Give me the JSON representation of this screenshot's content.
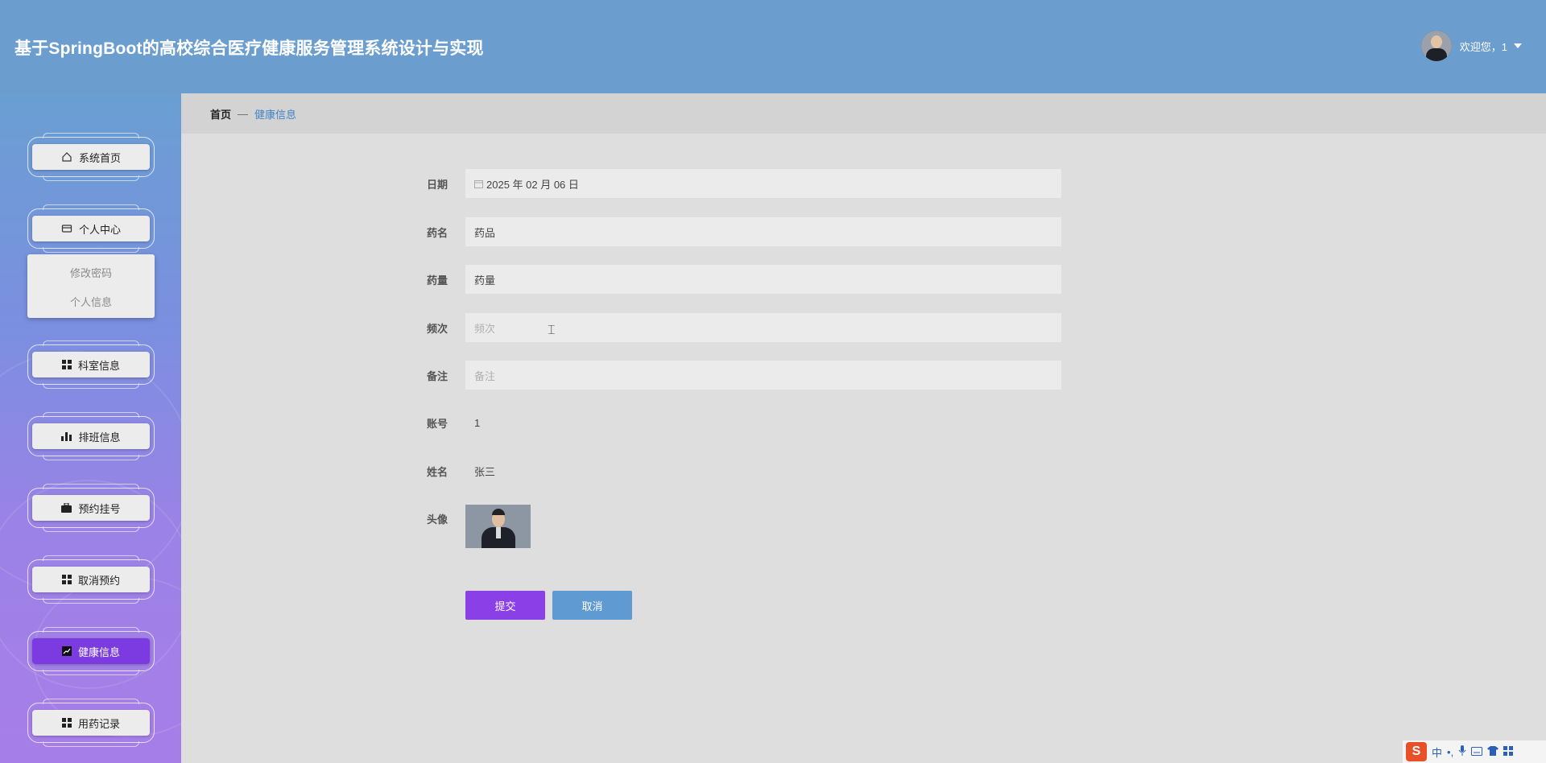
{
  "header": {
    "title": "基于SpringBoot的高校综合医疗健康服务管理系统设计与实现",
    "welcome": "欢迎您，1"
  },
  "sidebar": {
    "items": [
      {
        "label": "系统首页",
        "icon": "home-icon"
      },
      {
        "label": "个人中心",
        "icon": "wallet-icon"
      },
      {
        "label": "科室信息",
        "icon": "grid-icon"
      },
      {
        "label": "排班信息",
        "icon": "bar-chart-icon"
      },
      {
        "label": "预约挂号",
        "icon": "briefcase-icon"
      },
      {
        "label": "取消预约",
        "icon": "grid-icon"
      },
      {
        "label": "健康信息",
        "icon": "line-chart-icon",
        "active": true
      },
      {
        "label": "用药记录",
        "icon": "grid-icon"
      }
    ],
    "submenu": [
      "修改密码",
      "个人信息"
    ]
  },
  "breadcrumb": {
    "home": "首页",
    "separator": "—",
    "current": "健康信息"
  },
  "form": {
    "date": {
      "label": "日期",
      "value": "2025 年 02 月 06 日"
    },
    "drug_name": {
      "label": "药名",
      "value": "药品"
    },
    "dosage": {
      "label": "药量",
      "value": "药量"
    },
    "frequency": {
      "label": "频次",
      "placeholder": "频次"
    },
    "remark": {
      "label": "备注",
      "placeholder": "备注"
    },
    "account": {
      "label": "账号",
      "value": "1"
    },
    "name": {
      "label": "姓名",
      "value": "张三"
    },
    "avatar": {
      "label": "头像"
    },
    "submit_label": "提交",
    "cancel_label": "取消"
  },
  "ime": {
    "mode": "中",
    "punct": "•,"
  },
  "colors": {
    "header": "#6b9ece",
    "active_menu": "#7c3be0",
    "submit": "#8b3fe6",
    "cancel": "#5f9ad3",
    "breadcrumb_current": "#3f86c6"
  }
}
